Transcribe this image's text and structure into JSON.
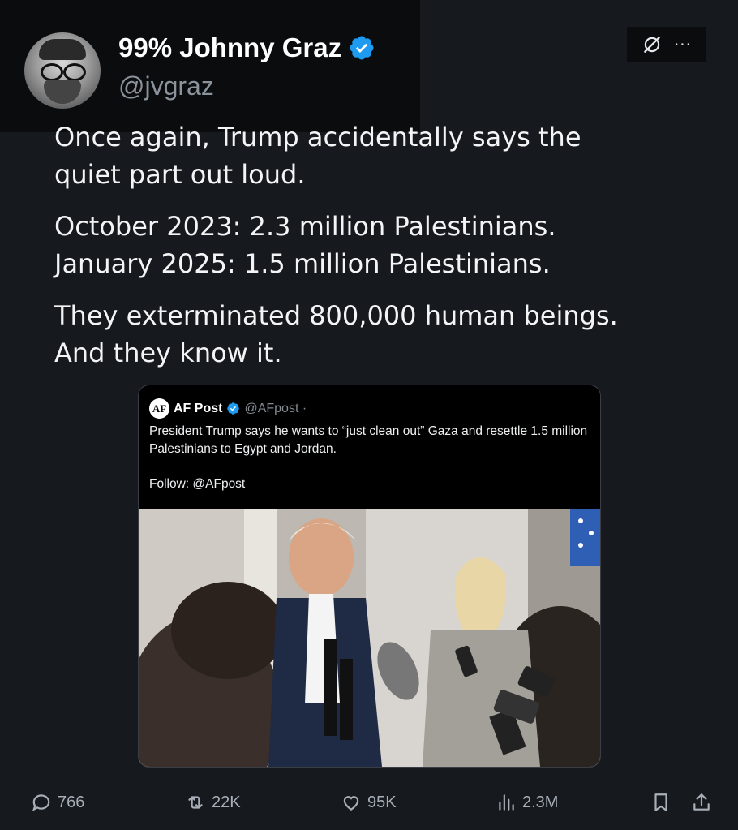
{
  "author": {
    "display_name": "99% Johnny Graz",
    "handle": "@jvgraz"
  },
  "top_actions": {
    "grok_icon": "grok-icon",
    "more_label": "···"
  },
  "tweet": {
    "paragraphs": [
      "Once again, Trump accidentally says the\nquiet part out loud.",
      "October 2023: 2.3 million Palestinians.\nJanuary 2025: 1.5 million Palestinians.",
      "They exterminated 800,000 human beings.\nAnd they know it."
    ]
  },
  "quote": {
    "logo_text": "AF",
    "name": "AF Post",
    "handle": "@AFpost ·",
    "text": "President Trump says he wants to “just clean out” Gaza and resettle 1.5 million Palestinians to Egypt and Jordan.",
    "follow": "Follow: @AFpost"
  },
  "actions": {
    "replies": "766",
    "reposts": "22K",
    "likes": "95K",
    "views": "2.3M"
  },
  "colors": {
    "verified": "#1d9bf0",
    "background": "#16191e",
    "muted": "#8b939c"
  }
}
